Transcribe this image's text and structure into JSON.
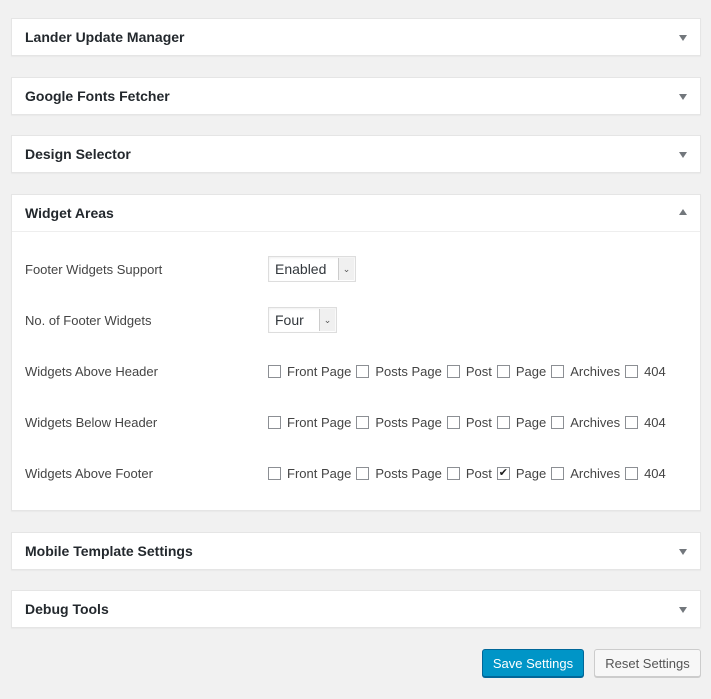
{
  "panels": [
    {
      "title": "Lander Update Manager",
      "expanded": false
    },
    {
      "title": "Google Fonts Fetcher",
      "expanded": false
    },
    {
      "title": "Design Selector",
      "expanded": false
    },
    {
      "title": "Widget Areas",
      "expanded": true
    },
    {
      "title": "Mobile Template Settings",
      "expanded": false
    },
    {
      "title": "Debug Tools",
      "expanded": false
    }
  ],
  "widget_areas": {
    "footer_support": {
      "label": "Footer Widgets Support",
      "value": "Enabled"
    },
    "footer_count": {
      "label": "No. of Footer Widgets",
      "value": "Four"
    },
    "option_labels": [
      "Front Page",
      "Posts Page",
      "Post",
      "Page",
      "Archives",
      "404"
    ],
    "rows": [
      {
        "label": "Widgets Above Header",
        "checked": [
          false,
          false,
          false,
          false,
          false,
          false
        ]
      },
      {
        "label": "Widgets Below Header",
        "checked": [
          false,
          false,
          false,
          false,
          false,
          false
        ]
      },
      {
        "label": "Widgets Above Footer",
        "checked": [
          false,
          false,
          false,
          true,
          false,
          false
        ]
      }
    ]
  },
  "icons": {
    "select_arrow": "chevron-down-icon",
    "collapsed": "triangle-down-icon",
    "expanded": "triangle-up-icon"
  },
  "buttons": {
    "save": "Save Settings",
    "reset": "Reset Settings"
  },
  "colors": {
    "primary": "#0095c7",
    "background": "#f1f1f1"
  }
}
